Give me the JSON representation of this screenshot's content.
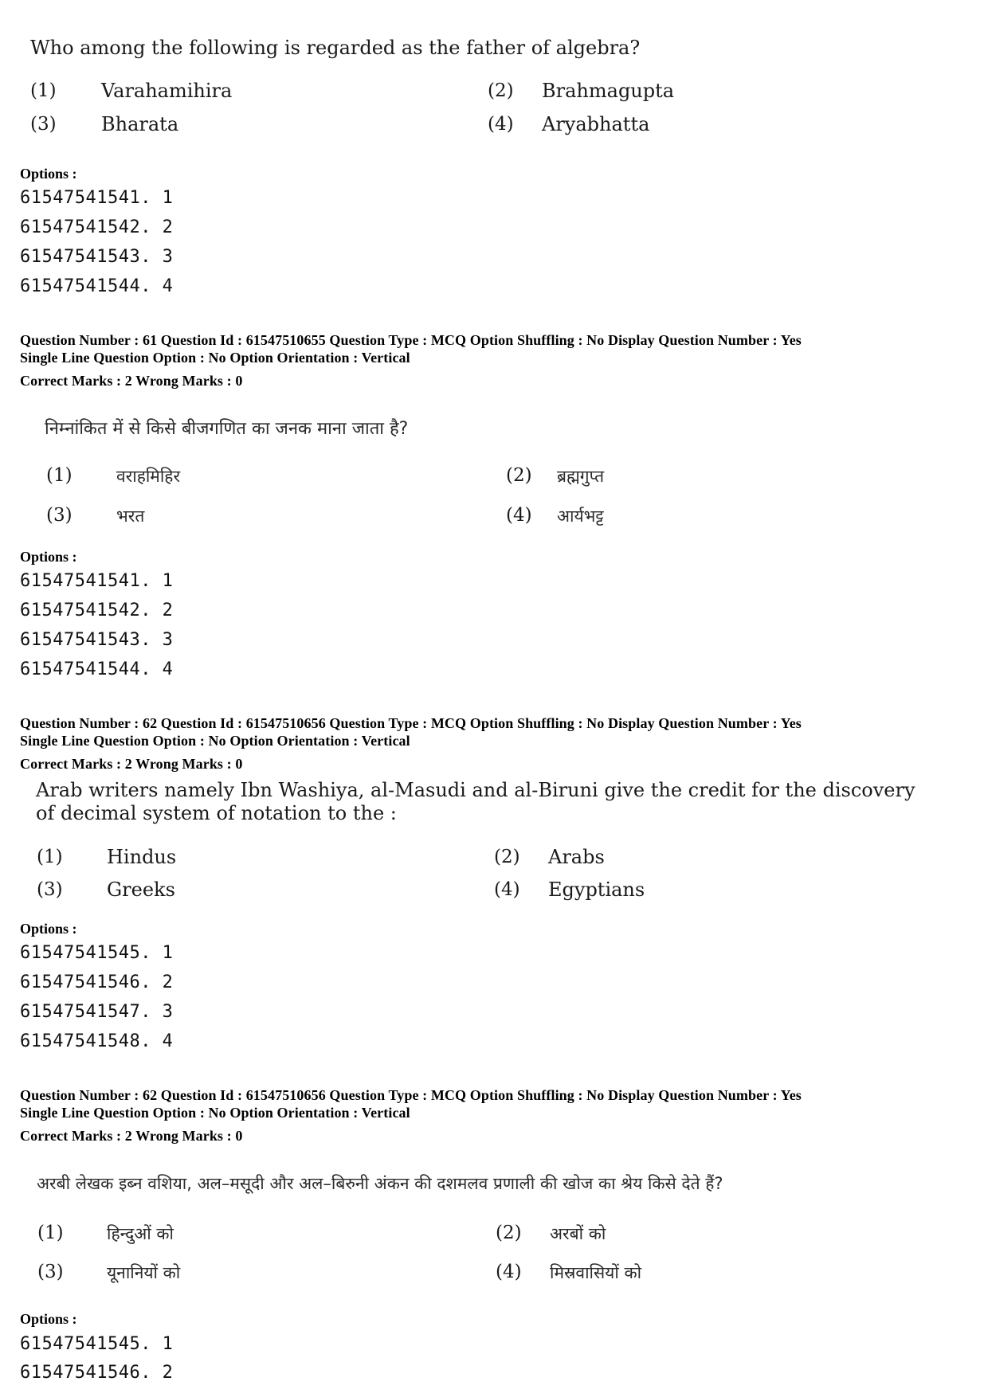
{
  "blocks": {
    "q60_en": {
      "question": "Who among the following is regarded as the father of algebra?",
      "choices": [
        {
          "num": "(1)",
          "text": "Varahamihira"
        },
        {
          "num": "(2)",
          "text": "Brahmagupta"
        },
        {
          "num": "(3)",
          "text": "Bharata"
        },
        {
          "num": "(4)",
          "text": "Aryabhatta"
        }
      ],
      "options_label": "Options :",
      "option_ids": [
        "61547541541. 1",
        "61547541542. 2",
        "61547541543. 3",
        "61547541544. 4"
      ]
    },
    "q61_hi": {
      "meta_line1": "Question Number : 61  Question Id : 61547510655  Question Type : MCQ  Option Shuffling : No  Display Question Number : Yes",
      "meta_line2": "Single Line Question Option : No  Option Orientation : Vertical",
      "marks": "Correct Marks : 2  Wrong Marks : 0",
      "question": "निम्नांकित में से किसे बीजगणित का जनक माना जाता है?",
      "choices": [
        {
          "num": "(1)",
          "text": "वराहमिहिर"
        },
        {
          "num": "(2)",
          "text": "ब्रह्मगुप्त"
        },
        {
          "num": "(3)",
          "text": "भरत"
        },
        {
          "num": "(4)",
          "text": "आर्यभट्ट"
        }
      ],
      "options_label": "Options :",
      "option_ids": [
        "61547541541. 1",
        "61547541542. 2",
        "61547541543. 3",
        "61547541544. 4"
      ]
    },
    "q62_en": {
      "meta_line1": "Question Number : 62  Question Id : 61547510656  Question Type : MCQ  Option Shuffling : No  Display Question Number : Yes",
      "meta_line2": "Single Line Question Option : No  Option Orientation : Vertical",
      "marks": "Correct Marks : 2  Wrong Marks : 0",
      "question_line1": "Arab writers namely Ibn Washiya, al-Masudi and al-Biruni give the credit for the discovery",
      "question_line2": "of decimal system of notation to the :",
      "choices": [
        {
          "num": "(1)",
          "text": "Hindus"
        },
        {
          "num": "(2)",
          "text": "Arabs"
        },
        {
          "num": "(3)",
          "text": "Greeks"
        },
        {
          "num": "(4)",
          "text": "Egyptians"
        }
      ],
      "options_label": "Options :",
      "option_ids": [
        "61547541545. 1",
        "61547541546. 2",
        "61547541547. 3",
        "61547541548. 4"
      ]
    },
    "q62_hi": {
      "meta_line1": "Question Number : 62  Question Id : 61547510656  Question Type : MCQ  Option Shuffling : No  Display Question Number : Yes",
      "meta_line2": "Single Line Question Option : No  Option Orientation : Vertical",
      "marks": "Correct Marks : 2  Wrong Marks : 0",
      "question": "अरबी लेखक इब्न वशिया, अल–मसूदी और अल–बिरुनी अंकन की दशमलव प्रणाली की खोज का श्रेय किसे देते हैं?",
      "choices": [
        {
          "num": "(1)",
          "text": "हिन्दुओं को"
        },
        {
          "num": "(2)",
          "text": "अरबों को"
        },
        {
          "num": "(3)",
          "text": "यूनानियों को"
        },
        {
          "num": "(4)",
          "text": "मिस्रवासियों को"
        }
      ],
      "options_label": "Options :",
      "option_ids": [
        "61547541545. 1",
        "61547541546. 2"
      ]
    }
  }
}
